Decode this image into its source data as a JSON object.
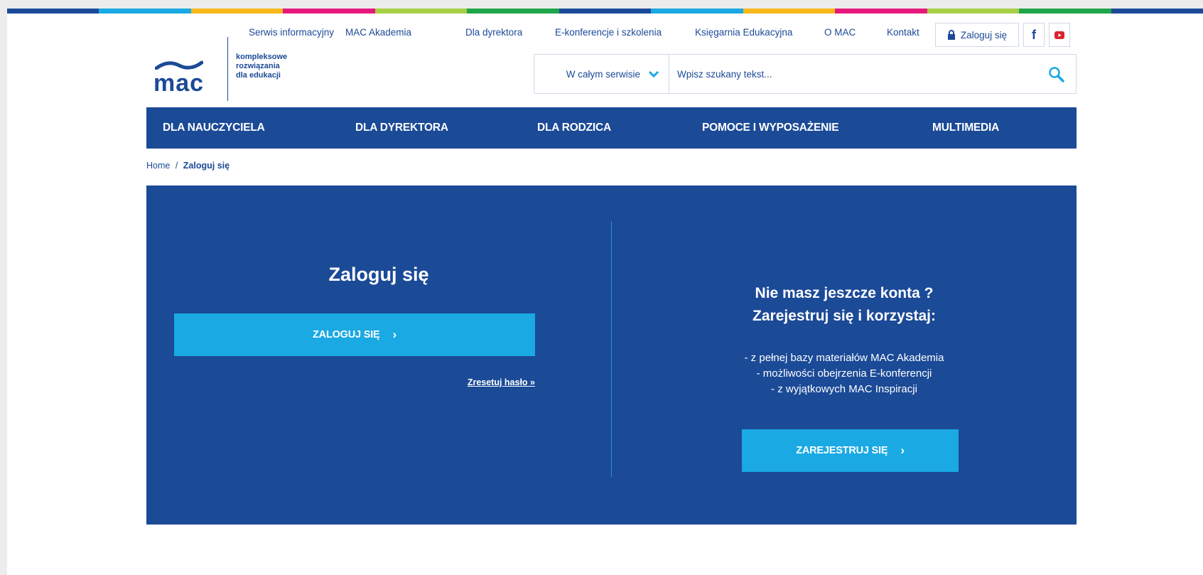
{
  "colors": {
    "brand_blue": "#1b4a97",
    "accent_cyan": "#1aa9e3",
    "stripe": [
      "#1b4a97",
      "#1aa9e3",
      "#f6b81b",
      "#e5197d",
      "#a8cf45",
      "#1fa64a",
      "#1b4a97",
      "#1aa9e3",
      "#f6b81b",
      "#e5197d",
      "#a8cf45",
      "#1fa64a",
      "#1b4a97"
    ]
  },
  "logo": {
    "word": "mac",
    "tagline": [
      "kompleksowe",
      "rozwiązania",
      "dla edukacji"
    ]
  },
  "toplinks": [
    "Serwis informacyjny",
    "MAC Akademia",
    "Dla dyrektora",
    "E-konferencje i szkolenia",
    "Księgarnia Edukacyjna",
    "O MAC",
    "Kontakt"
  ],
  "login_top": {
    "label": "Zaloguj się",
    "icon": "lock-icon"
  },
  "social": [
    {
      "name": "facebook-icon",
      "glyph": "f"
    },
    {
      "name": "youtube-icon",
      "glyph": "▶"
    }
  ],
  "search": {
    "scope": "W całym serwisie",
    "placeholder": "Wpisz szukany tekst...",
    "icon": "search-icon"
  },
  "nav": [
    "DLA NAUCZYCIELA",
    "DLA DYREKTORA",
    "DLA RODZICA",
    "POMOCE I WYPOSAŻENIE",
    "MULTIMEDIA"
  ],
  "breadcrumb": {
    "home": "Home",
    "separator": "/",
    "current": "Zaloguj się"
  },
  "login": {
    "title": "Zaloguj się",
    "button": "ZALOGUJ SIĘ",
    "reset": "Zresetuj hasło »"
  },
  "register": {
    "heading1": "Nie masz jeszcze konta ?",
    "heading2": "Zarejestruj się i korzystaj:",
    "items": [
      "- z pełnej bazy materiałów MAC Akademia",
      "- możliwości obejrzenia E-konferencji",
      "- z wyjątkowych MAC Inspiracji"
    ],
    "button": "ZAREJESTRUJ SIĘ"
  }
}
